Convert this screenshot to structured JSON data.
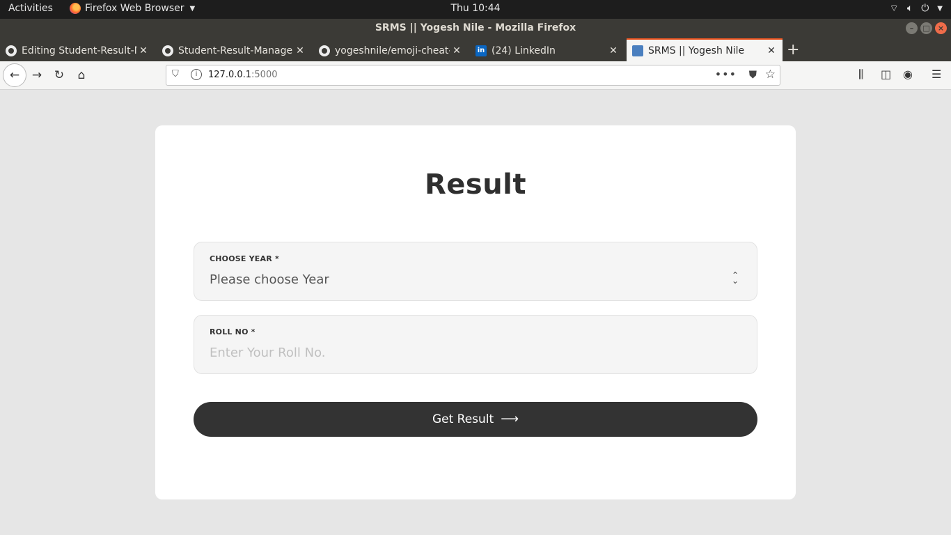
{
  "topbar": {
    "activities": "Activities",
    "app_name": "Firefox Web Browser",
    "clock": "Thu 10:44"
  },
  "window": {
    "title": "SRMS || Yogesh Nile - Mozilla Firefox"
  },
  "tabs": [
    {
      "label": "Editing Student-Result-M",
      "icon": "github-icon",
      "active": false
    },
    {
      "label": "Student-Result-Managem",
      "icon": "github-icon",
      "active": false
    },
    {
      "label": "yogeshnile/emoji-cheat-s",
      "icon": "github-icon",
      "active": false
    },
    {
      "label": "(24) LinkedIn",
      "icon": "linkedin-icon",
      "active": false
    },
    {
      "label": "SRMS || Yogesh Nile",
      "icon": "srms-favicon",
      "active": true
    }
  ],
  "urlbar": {
    "host": "127.0.0.1",
    "port": ":5000"
  },
  "page": {
    "heading": "Result",
    "year_field": {
      "label": "CHOOSE YEAR *",
      "selected": "Please choose Year"
    },
    "roll_field": {
      "label": "ROLL NO *",
      "placeholder": "Enter Your Roll No."
    },
    "submit_label": "Get Result",
    "submit_arrow": "⟶"
  },
  "colors": {
    "page_bg": "#e6e6e6",
    "card_bg": "#ffffff",
    "button_bg": "#333333",
    "accent_tab": "#e95420"
  }
}
